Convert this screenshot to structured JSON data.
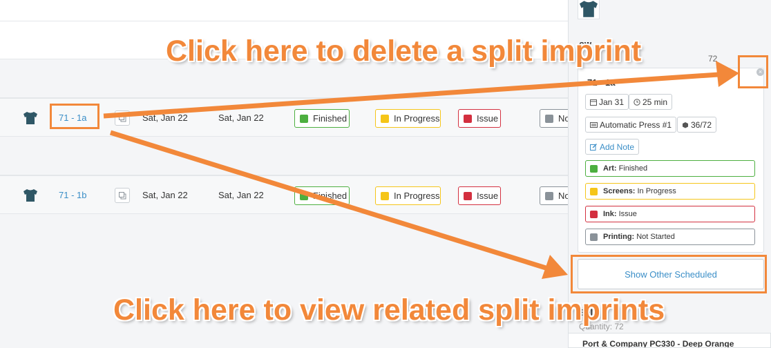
{
  "rows": [
    {
      "job": "71 - 1a",
      "date_1": "Sat, Jan 22",
      "date_2": "Sat, Jan 22",
      "statuses": [
        {
          "label": "Finished",
          "color": "#4caf3f"
        },
        {
          "label": "In Progress",
          "color": "#f5c518"
        },
        {
          "label": "Issue",
          "color": "#d32f3f"
        },
        {
          "label": "No",
          "color": "#8a9299"
        }
      ]
    },
    {
      "job": "71 - 1b",
      "date_1": "Sat, Jan 22",
      "date_2": "Sat, Jan 22",
      "statuses": [
        {
          "label": "Finished",
          "color": "#4caf3f"
        },
        {
          "label": "In Progress",
          "color": "#f5c518"
        },
        {
          "label": "Issue",
          "color": "#d32f3f"
        },
        {
          "label": "No",
          "color": "#8a9299"
        }
      ]
    }
  ],
  "panel": {
    "partial_heading": "ow",
    "partial_quantity": "72",
    "card": {
      "title": "71 - 1a",
      "date": "Jan 31",
      "duration": "25 min",
      "press": "Automatic Press #1",
      "count": "36/72",
      "add_note": "Add Note",
      "stages": [
        {
          "name": "Art:",
          "value": "Finished",
          "color": "#4caf3f"
        },
        {
          "name": "Screens:",
          "value": "In Progress",
          "color": "#f5c518"
        },
        {
          "name": "Ink:",
          "value": "Issue",
          "color": "#d32f3f"
        },
        {
          "name": "Printing:",
          "value": "Not Started",
          "color": "#8a9299"
        }
      ]
    },
    "show_other": "Show Other Scheduled",
    "split_heading": "Split It",
    "quantity": "Quantity: 72",
    "product": "Port & Company PC330 - Deep Orange"
  },
  "annotations": {
    "delete_callout": "Click here to delete a split imprint",
    "view_callout": "Click here to view related split imprints",
    "accent": "#f2883a"
  },
  "icons": [
    "tshirt-icon",
    "copy-icon",
    "calendar-icon",
    "clock-icon",
    "press-icon",
    "box-icon",
    "edit-icon",
    "close-icon"
  ]
}
